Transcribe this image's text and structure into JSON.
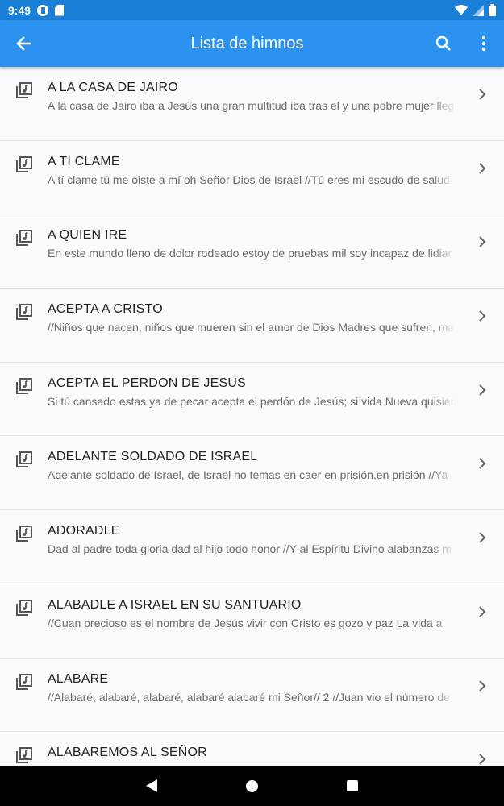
{
  "status": {
    "time": "9:49"
  },
  "header": {
    "title": "Lista de himnos",
    "back_icon": "arrow-back-icon",
    "search_icon": "search-icon",
    "menu_icon": "more-vert-icon",
    "color": "#2b92ef"
  },
  "hymns": [
    {
      "title": "A LA CASA DE JAIRO",
      "preview": "A la casa de Jairo iba a Jesús una gran multitud iba tras el y una pobre mujer lleg"
    },
    {
      "title": "A TI CLAME",
      "preview": "A tí clame tú me oiste a mí oh Señor Dios de Israel //Tú eres mi escudo de salud"
    },
    {
      "title": "A QUIEN IRE",
      "preview": "En este mundo lleno de dolor rodeado estoy de pruebas mil soy incapaz de lidiar"
    },
    {
      "title": "ACEPTA A CRISTO",
      "preview": "//Niños que nacen, niños que mueren sin el amor de Dios Madres que sufren, ma"
    },
    {
      "title": "ACEPTA EL PERDON DE JESUS",
      "preview": "Si tú cansado estas ya de pecar acepta el perdón de Jesús; si vida Nueva quisier"
    },
    {
      "title": "ADELANTE SOLDADO DE ISRAEL",
      "preview": "Adelante soldado de Israel, de Israel no temas en caer en prisión,en prisión //Ya"
    },
    {
      "title": "ADORADLE",
      "preview": "Dad al padre toda gloria dad al hijo todo honor //Y al Espíritu Divino alabanzas m"
    },
    {
      "title": "ALABADLE A ISRAEL EN SU SANTUARIO",
      "preview": "//Cuan precioso es el nombre de Jesús vivir con Cristo es gozo y paz La vida a"
    },
    {
      "title": "ALABARE",
      "preview": "//Alabaré, alabaré, alabaré, alabaré alabaré mi Señor// 2 //Juan vio el número de"
    },
    {
      "title": "ALABAREMOS AL SEÑOR",
      "preview": ""
    }
  ]
}
